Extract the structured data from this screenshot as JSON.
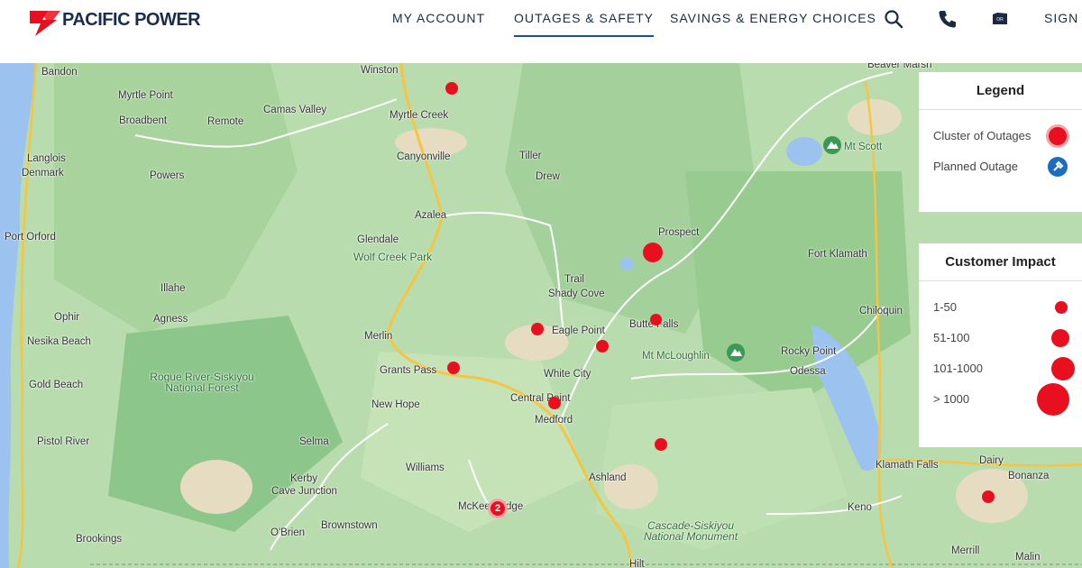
{
  "brand": {
    "name": "PACIFIC POWER",
    "accent": "#1d4f91",
    "red": "#e8101e"
  },
  "nav": {
    "items": [
      {
        "label": "MY ACCOUNT"
      },
      {
        "label": "OUTAGES & SAFETY",
        "active": true
      },
      {
        "label": "SAVINGS & ENERGY CHOICES"
      }
    ],
    "icons": [
      "search-icon",
      "phone-icon",
      "state-oregon-icon"
    ],
    "sign_in": "SIGN I"
  },
  "legend": {
    "title": "Legend",
    "items": [
      {
        "label": "Cluster of Outages",
        "icon": "cluster-icon"
      },
      {
        "label": "Planned Outage",
        "icon": "planned-outage-icon"
      }
    ]
  },
  "impact": {
    "title": "Customer Impact",
    "items": [
      {
        "label": "1-50"
      },
      {
        "label": "51-100"
      },
      {
        "label": "101-1000"
      },
      {
        "label": "> 1000"
      }
    ]
  },
  "map": {
    "places": [
      "Bandon",
      "Winston",
      "Beaver Marsh",
      "Myrtle Point",
      "Broadbent",
      "Remote",
      "Camas Valley",
      "Myrtle Creek",
      "Langlois",
      "Denmark",
      "Powers",
      "Canyonville",
      "Tiller",
      "Drew",
      "Mt Scott",
      "Azalea",
      "Glendale",
      "Prospect",
      "Port Orford",
      "Fort Klamath",
      "Trail",
      "Shady Cove",
      "Illahe",
      "Ophir",
      "Agness",
      "Butte Falls",
      "Chiloquin",
      "Nesika Beach",
      "Merlin",
      "Eagle Point",
      "Mt McLoughlin",
      "Rocky Point",
      "Grants Pass",
      "White City",
      "Odessa",
      "Gold Beach",
      "New Hope",
      "Central Point",
      "Medford",
      "Pistol River",
      "Selma",
      "Williams",
      "Ashland",
      "Klamath Falls",
      "Dairy",
      "Bonanza",
      "Kerby",
      "Cave Junction",
      "McKee Bridge",
      "Keno",
      "Brownstown",
      "O'Brien",
      "Brookings",
      "Hilt",
      "Merrill",
      "Malin"
    ],
    "parks": [
      "Wolf Creek Park",
      "Rogue River-Siskiyou National Forest",
      "Cascade-Siskiyou National Monument"
    ],
    "cluster_count": "2"
  }
}
